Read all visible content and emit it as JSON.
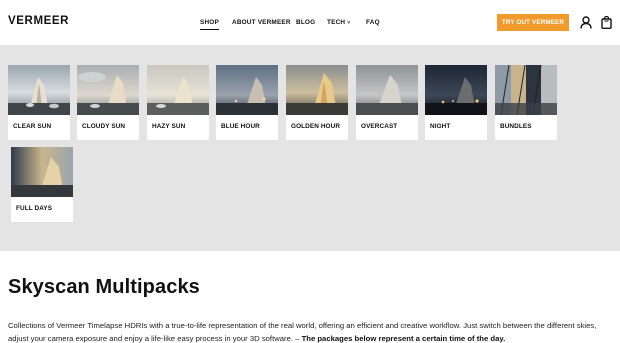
{
  "brand": {
    "logo": "VERMEER"
  },
  "nav": {
    "items": [
      {
        "label": "SHOP"
      },
      {
        "label": "ABOUT VERMEER"
      },
      {
        "label": "BLOG"
      },
      {
        "label": "TECH"
      },
      {
        "label": "FAQ"
      }
    ],
    "active": "SHOP",
    "tech_caret": "˅"
  },
  "cta": {
    "label": "TRY OUT VERMEER",
    "color": "#f29b2d"
  },
  "icons": {
    "account": "user-icon",
    "cart": "shopping-bag-icon"
  },
  "shop_menu": {
    "items": [
      {
        "label": "CLEAR SUN"
      },
      {
        "label": "CLOUDY SUN"
      },
      {
        "label": "HAZY SUN"
      },
      {
        "label": "BLUE HOUR"
      },
      {
        "label": "GOLDEN HOUR"
      },
      {
        "label": "OVERCAST"
      },
      {
        "label": "NIGHT"
      },
      {
        "label": "BUNDLES"
      },
      {
        "label": "FULL DAYS"
      }
    ],
    "background": "#e4e4e4"
  },
  "main": {
    "title": "Skyscan Multipacks",
    "intro_text": "Collections of Vermeer Timelapse HDRIs with a true-to-life representation of the real world, offering an efficient and creative workflow. Just switch between the different skies, adjust your camera exposure and enjoy a life-like easy process in your 3D software.  –  ",
    "intro_bold": "The packages below represent a certain time of the day."
  }
}
